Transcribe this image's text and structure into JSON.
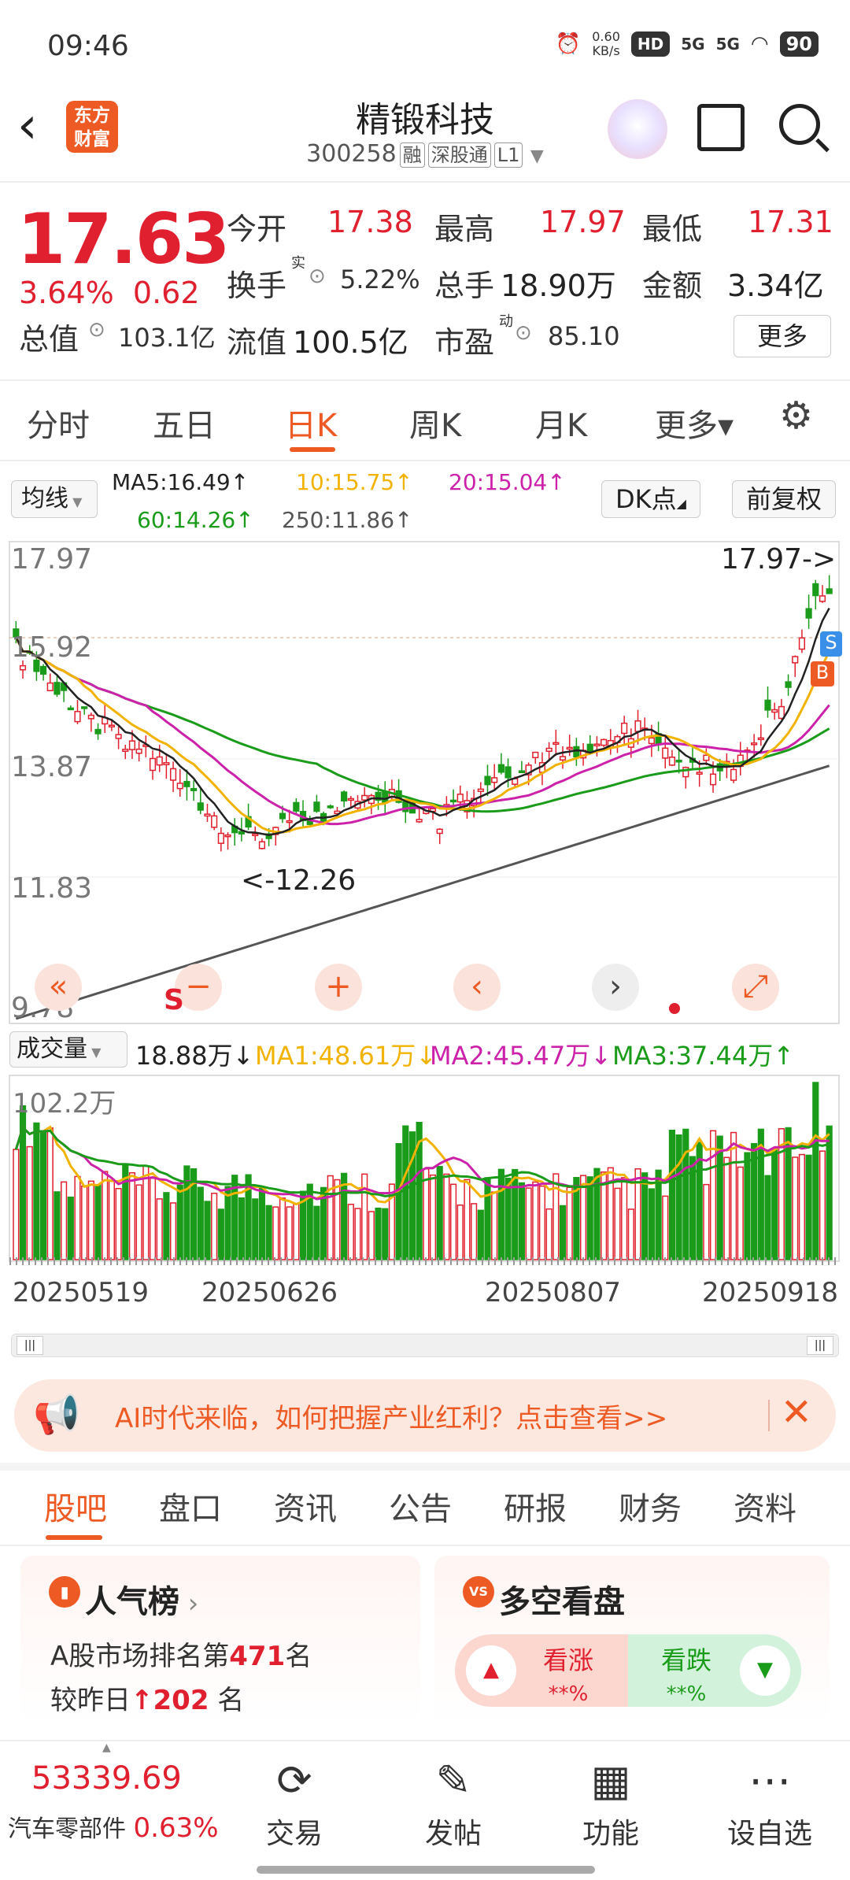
{
  "status": {
    "time": "09:46",
    "speed_value": "0.60",
    "speed_unit": "KB/s",
    "hd": "HD",
    "net1": "5G",
    "net2": "5G",
    "battery": "90"
  },
  "header": {
    "logo_text_1": "东方",
    "logo_text_2": "财富",
    "title": "精锻科技",
    "code": "300258",
    "tags": [
      "融",
      "深股通",
      "L1"
    ]
  },
  "quote": {
    "price": "17.63",
    "change_pct": "3.64%",
    "change": "0.62",
    "rows": [
      [
        {
          "label": "今开",
          "value": "17.38",
          "color": "red"
        },
        {
          "label": "最高",
          "value": "17.97",
          "color": "red"
        },
        {
          "label": "最低",
          "value": "17.31",
          "color": "red"
        }
      ],
      [
        {
          "label": "换手",
          "sup": "实",
          "value": "5.22%",
          "color": "dark"
        },
        {
          "label": "总手",
          "value": "18.90万",
          "color": "dark"
        },
        {
          "label": "金额",
          "value": "3.34亿",
          "color": "dark"
        }
      ],
      [
        {
          "label": "总值",
          "value": "103.1亿",
          "color": "dark"
        },
        {
          "label": "流值",
          "value": "100.5亿",
          "color": "dark"
        },
        {
          "label": "市盈",
          "sup": "动",
          "value": "85.10",
          "color": "dark"
        }
      ]
    ],
    "more": "更多"
  },
  "tabs": [
    "分时",
    "五日",
    "日K",
    "周K",
    "月K",
    "更多▾"
  ],
  "active_tab": "日K",
  "ma": {
    "selector": "均线",
    "ma5": "MA5:16.49↑",
    "ma10": "10:15.75↑",
    "ma20": "20:15.04↑",
    "ma60": "60:14.26↑",
    "ma250": "250:11.86↑",
    "dk": "DK点",
    "adjust": "前复权"
  },
  "chart": {
    "y_labels": [
      "17.97",
      "15.92",
      "13.87",
      "11.83",
      "9.78"
    ],
    "high_note": "17.97->",
    "low_note": "<-12.26",
    "markers": {
      "s": "S",
      "b": "B"
    }
  },
  "volume": {
    "selector": "成交量",
    "value": "18.88万↓",
    "ma1": "MA1:48.61万↓",
    "ma2": "MA2:45.47万↓",
    "ma3": "MA3:37.44万↑",
    "max_label": "102.2万"
  },
  "dates": [
    "20250519",
    "20250626",
    "20250807",
    "20250918"
  ],
  "banner": {
    "text": "AI时代来临，如何把握产业红利？点击查看>>"
  },
  "tabs2": [
    "股吧",
    "盘口",
    "资讯",
    "公告",
    "研报",
    "财务",
    "资料"
  ],
  "active_tab2": "股吧",
  "popularity": {
    "title": "人气榜",
    "line1_prefix": "A股市场排名第",
    "rank": "471",
    "line1_suffix": "名",
    "line2_prefix": "较昨日",
    "delta": "202",
    "line2_suffix": "名"
  },
  "bullbear": {
    "title": "多空看盘",
    "bull": "看涨",
    "bull_pct": "**%",
    "bear": "看跌",
    "bear_pct": "**%"
  },
  "bottom": {
    "index_value": "53339.69",
    "index_name": "汽车零部件",
    "index_pct": "0.63%",
    "items": [
      "交易",
      "发帖",
      "功能",
      "设自选"
    ]
  }
}
